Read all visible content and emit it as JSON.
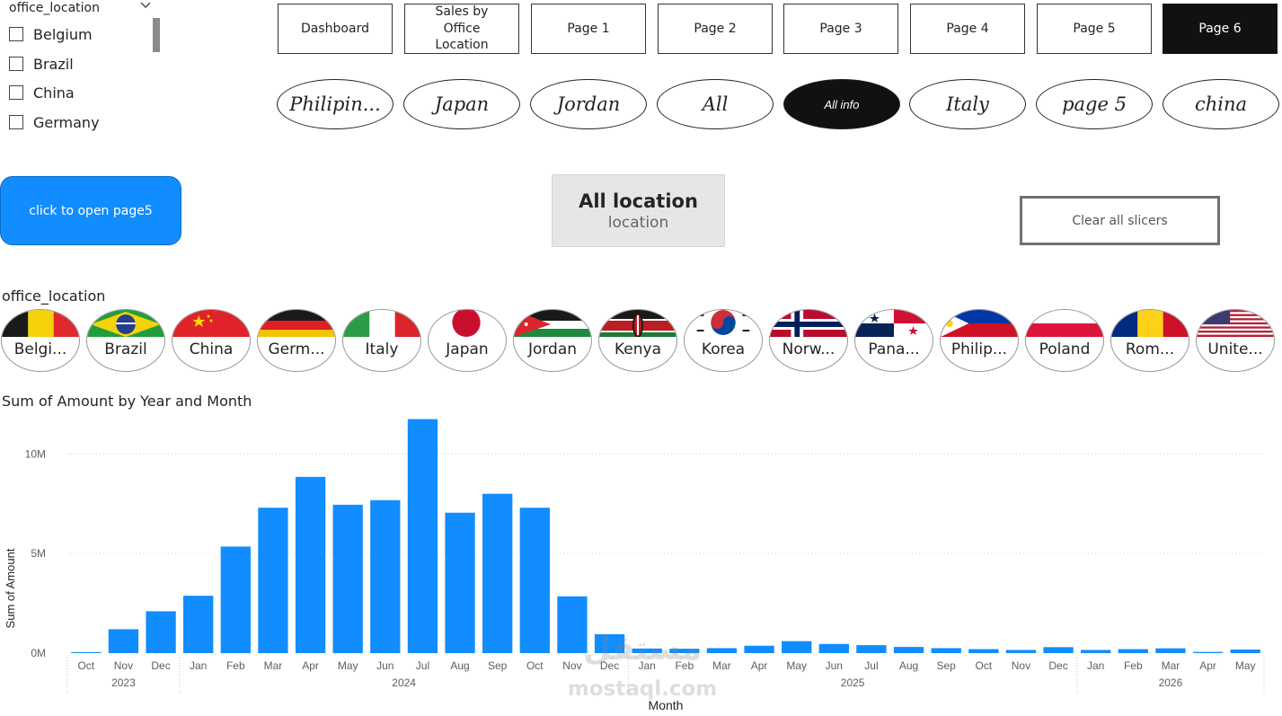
{
  "slicer": {
    "title": "office_location",
    "items": [
      {
        "label": "Belgium"
      },
      {
        "label": "Brazil"
      },
      {
        "label": "China"
      },
      {
        "label": "Germany"
      }
    ]
  },
  "nav_buttons": [
    {
      "label": "Dashboard",
      "active": false
    },
    {
      "label": "Sales by Office Location",
      "active": false
    },
    {
      "label": "Page 1",
      "active": false
    },
    {
      "label": "Page 2",
      "active": false
    },
    {
      "label": "Page 3",
      "active": false
    },
    {
      "label": "Page 4",
      "active": false
    },
    {
      "label": "Page 5",
      "active": false
    },
    {
      "label": "Page 6",
      "active": true
    }
  ],
  "oval_buttons": [
    {
      "label": "Philipin...",
      "active": false
    },
    {
      "label": "Japan",
      "active": false
    },
    {
      "label": "Jordan",
      "active": false
    },
    {
      "label": "All",
      "active": false
    },
    {
      "label": "All info",
      "active": true
    },
    {
      "label": "Italy",
      "active": false
    },
    {
      "label": "page 5",
      "active": false
    },
    {
      "label": "china",
      "active": false
    }
  ],
  "open_page5_button": {
    "label": "click to open page5"
  },
  "card": {
    "value": "All location",
    "label": "location"
  },
  "clear_button": {
    "label": "Clear all slicers"
  },
  "flag_slicer": {
    "title": "office_location",
    "items": [
      {
        "label": "Belgi...",
        "flag": "belgium-flag-icon"
      },
      {
        "label": "Brazil",
        "flag": "brazil-flag-icon"
      },
      {
        "label": "China",
        "flag": "china-flag-icon"
      },
      {
        "label": "Germ...",
        "flag": "germany-flag-icon"
      },
      {
        "label": "Italy",
        "flag": "italy-flag-icon"
      },
      {
        "label": "Japan",
        "flag": "japan-flag-icon"
      },
      {
        "label": "Jordan",
        "flag": "jordan-flag-icon"
      },
      {
        "label": "Kenya",
        "flag": "kenya-flag-icon"
      },
      {
        "label": "Korea",
        "flag": "korea-flag-icon"
      },
      {
        "label": "Norw...",
        "flag": "norway-flag-icon"
      },
      {
        "label": "Pana...",
        "flag": "panama-flag-icon"
      },
      {
        "label": "Philip...",
        "flag": "philippines-flag-icon"
      },
      {
        "label": "Poland",
        "flag": "poland-flag-icon"
      },
      {
        "label": "Rom...",
        "flag": "romania-flag-icon"
      },
      {
        "label": "Unite...",
        "flag": "usa-flag-icon"
      }
    ]
  },
  "chart_data": {
    "type": "bar",
    "title": "Sum of Amount by Year and Month",
    "xlabel": "Month",
    "ylabel": "Sum of Amount",
    "ylim": [
      0,
      12000000
    ],
    "yticks": [
      {
        "value": 0,
        "label": "0M"
      },
      {
        "value": 5000000,
        "label": "5M"
      },
      {
        "value": 10000000,
        "label": "10M"
      }
    ],
    "grid": true,
    "color": "#118DFF",
    "years": [
      {
        "label": "2023",
        "months": 3
      },
      {
        "label": "2024",
        "months": 12
      },
      {
        "label": "2025",
        "months": 12
      },
      {
        "label": "2026",
        "months": 5
      }
    ],
    "categories": [
      "Oct",
      "Nov",
      "Dec",
      "Jan",
      "Feb",
      "Mar",
      "Apr",
      "May",
      "Jun",
      "Jul",
      "Aug",
      "Sep",
      "Oct",
      "Nov",
      "Dec",
      "Jan",
      "Feb",
      "Mar",
      "Apr",
      "May",
      "Jun",
      "Jul",
      "Aug",
      "Sep",
      "Oct",
      "Nov",
      "Dec",
      "Jan",
      "Feb",
      "Mar",
      "Apr",
      "May"
    ],
    "values": [
      50000,
      1200000,
      2100000,
      2880000,
      5350000,
      7300000,
      8850000,
      7450000,
      7680000,
      11750000,
      7050000,
      8000000,
      7300000,
      2850000,
      950000,
      230000,
      220000,
      250000,
      370000,
      600000,
      460000,
      400000,
      310000,
      250000,
      200000,
      160000,
      300000,
      160000,
      200000,
      240000,
      60000,
      180000
    ]
  },
  "watermark": {
    "brand": "مستقل",
    "site": "mostaql.com"
  }
}
